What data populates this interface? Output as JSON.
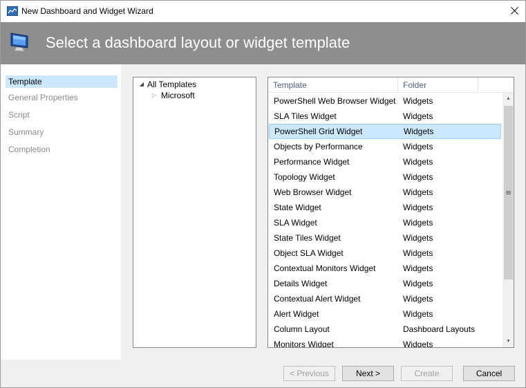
{
  "window": {
    "title": "New Dashboard and Widget Wizard"
  },
  "header": {
    "title": "Select a dashboard layout or widget template"
  },
  "nav": {
    "items": [
      {
        "label": "Template",
        "active": true
      },
      {
        "label": "General Properties",
        "active": false
      },
      {
        "label": "Script",
        "active": false
      },
      {
        "label": "Summary",
        "active": false
      },
      {
        "label": "Completion",
        "active": false
      }
    ]
  },
  "tree": {
    "root": "All Templates",
    "child": "Microsoft"
  },
  "list": {
    "columns": [
      "Template",
      "Folder"
    ],
    "rows": [
      {
        "template": "PowerShell Web Browser Widget",
        "folder": "Widgets"
      },
      {
        "template": "SLA Tiles Widget",
        "folder": "Widgets"
      },
      {
        "template": "PowerShell Grid Widget",
        "folder": "Widgets",
        "selected": true
      },
      {
        "template": "Objects by Performance",
        "folder": "Widgets"
      },
      {
        "template": "Performance Widget",
        "folder": "Widgets"
      },
      {
        "template": "Topology Widget",
        "folder": "Widgets"
      },
      {
        "template": "Web Browser Widget",
        "folder": "Widgets"
      },
      {
        "template": "State Widget",
        "folder": "Widgets"
      },
      {
        "template": "SLA Widget",
        "folder": "Widgets"
      },
      {
        "template": "State Tiles Widget",
        "folder": "Widgets"
      },
      {
        "template": "Object SLA Widget",
        "folder": "Widgets"
      },
      {
        "template": "Contextual Monitors Widget",
        "folder": "Widgets"
      },
      {
        "template": "Details Widget",
        "folder": "Widgets"
      },
      {
        "template": "Contextual Alert Widget",
        "folder": "Widgets"
      },
      {
        "template": "Alert Widget",
        "folder": "Widgets"
      },
      {
        "template": "Column Layout",
        "folder": "Dashboard Layouts"
      },
      {
        "template": "Monitors Widget",
        "folder": "Widgets"
      }
    ]
  },
  "buttons": {
    "previous": "< Previous",
    "next": "Next >",
    "create": "Create",
    "cancel": "Cancel"
  },
  "colors": {
    "header_bg": "#8e8e8e",
    "selection_bg": "#cce8ff",
    "selection_border": "#99d1ff",
    "column_header_text": "#4d6082"
  },
  "icons": {
    "app": "dashboard-chart-icon",
    "header": "monitor-icon",
    "close": "close-icon"
  }
}
